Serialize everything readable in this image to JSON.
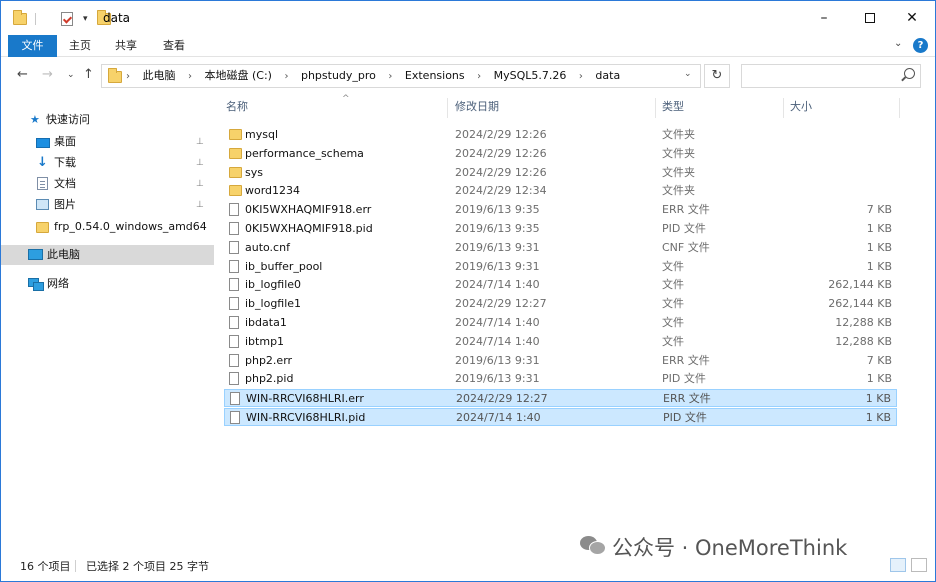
{
  "window": {
    "title": "data",
    "controls": {
      "minimize": "–",
      "maximize": "max",
      "close": "✕"
    }
  },
  "ribbon": {
    "tabs": [
      "文件",
      "主页",
      "共享",
      "查看"
    ],
    "collapse_glyph": "⌄",
    "help_glyph": "?"
  },
  "nav": {
    "back_glyph": "←",
    "forward_glyph": "→",
    "recent_glyph": "⌄",
    "up_glyph": "↑",
    "breadcrumbs": [
      "此电脑",
      "本地磁盘 (C:)",
      "phpstudy_pro",
      "Extensions",
      "MySQL5.7.26",
      "data"
    ],
    "dropdown_glyph": "⌄",
    "refresh_glyph": "↻",
    "search_placeholder": ""
  },
  "sidebar": {
    "quick_access": {
      "label": "快速访问",
      "icon": "star-icon"
    },
    "items": [
      {
        "label": "桌面",
        "icon": "desktop-icon",
        "pinned": true
      },
      {
        "label": "下载",
        "icon": "download-icon",
        "pinned": true
      },
      {
        "label": "文档",
        "icon": "documents-icon",
        "pinned": true
      },
      {
        "label": "图片",
        "icon": "pictures-icon",
        "pinned": true
      },
      {
        "label": "frp_0.54.0_windows_amd64",
        "icon": "folder-icon",
        "pinned": false
      }
    ],
    "this_pc": {
      "label": "此电脑",
      "icon": "computer-icon",
      "selected": true
    },
    "network": {
      "label": "网络",
      "icon": "network-icon"
    },
    "pin_glyph": "📌"
  },
  "columns": {
    "name": "名称",
    "date": "修改日期",
    "type": "类型",
    "size": "大小"
  },
  "files": [
    {
      "name": "mysql",
      "date": "2024/2/29 12:26",
      "type": "文件夹",
      "size": "",
      "kind": "folder",
      "selected": false
    },
    {
      "name": "performance_schema",
      "date": "2024/2/29 12:26",
      "type": "文件夹",
      "size": "",
      "kind": "folder",
      "selected": false
    },
    {
      "name": "sys",
      "date": "2024/2/29 12:26",
      "type": "文件夹",
      "size": "",
      "kind": "folder",
      "selected": false
    },
    {
      "name": "word1234",
      "date": "2024/2/29 12:34",
      "type": "文件夹",
      "size": "",
      "kind": "folder",
      "selected": false
    },
    {
      "name": "0KI5WXHAQMIF918.err",
      "date": "2019/6/13 9:35",
      "type": "ERR 文件",
      "size": "7 KB",
      "kind": "file",
      "selected": false
    },
    {
      "name": "0KI5WXHAQMIF918.pid",
      "date": "2019/6/13 9:35",
      "type": "PID 文件",
      "size": "1 KB",
      "kind": "file",
      "selected": false
    },
    {
      "name": "auto.cnf",
      "date": "2019/6/13 9:31",
      "type": "CNF 文件",
      "size": "1 KB",
      "kind": "file",
      "selected": false
    },
    {
      "name": "ib_buffer_pool",
      "date": "2019/6/13 9:31",
      "type": "文件",
      "size": "1 KB",
      "kind": "file",
      "selected": false
    },
    {
      "name": "ib_logfile0",
      "date": "2024/7/14 1:40",
      "type": "文件",
      "size": "262,144 KB",
      "kind": "file",
      "selected": false
    },
    {
      "name": "ib_logfile1",
      "date": "2024/2/29 12:27",
      "type": "文件",
      "size": "262,144 KB",
      "kind": "file",
      "selected": false
    },
    {
      "name": "ibdata1",
      "date": "2024/7/14 1:40",
      "type": "文件",
      "size": "12,288 KB",
      "kind": "file",
      "selected": false
    },
    {
      "name": "ibtmp1",
      "date": "2024/7/14 1:40",
      "type": "文件",
      "size": "12,288 KB",
      "kind": "file",
      "selected": false
    },
    {
      "name": "php2.err",
      "date": "2019/6/13 9:31",
      "type": "ERR 文件",
      "size": "7 KB",
      "kind": "file",
      "selected": false
    },
    {
      "name": "php2.pid",
      "date": "2019/6/13 9:31",
      "type": "PID 文件",
      "size": "1 KB",
      "kind": "file",
      "selected": false
    },
    {
      "name": "WIN-RRCVI68HLRI.err",
      "date": "2024/2/29 12:27",
      "type": "ERR 文件",
      "size": "1 KB",
      "kind": "file",
      "selected": true
    },
    {
      "name": "WIN-RRCVI68HLRI.pid",
      "date": "2024/7/14 1:40",
      "type": "PID 文件",
      "size": "1 KB",
      "kind": "file",
      "selected": true
    }
  ],
  "status": {
    "item_count": "16 个项目",
    "selected": "已选择 2 个项目  25 字节"
  },
  "watermark": "公众号 · OneMoreThink",
  "colors": {
    "accent": "#1979ca",
    "selection": "#cce8ff",
    "selection_border": "#99d1ff",
    "folder": "#f7d26a"
  }
}
